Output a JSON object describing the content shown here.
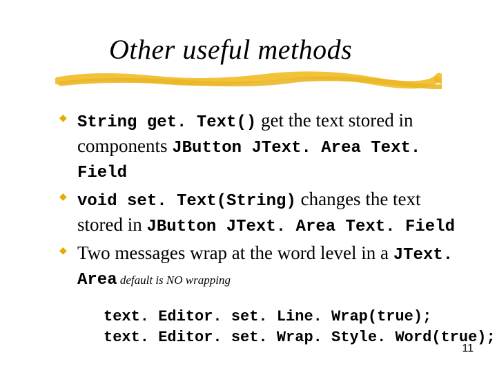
{
  "title": "Other useful methods",
  "bullets": [
    {
      "sig": "String get. Text()",
      "lead": " get the text stored in components ",
      "classes": "JButton JText. Area Text. Field"
    },
    {
      "sig": "void set. Text(String)",
      "lead": " changes the text stored in ",
      "classes": "JButton JText. Area Text. Field"
    },
    {
      "sig": "",
      "lead": "Two messages wrap at the word level in a ",
      "classes": "JText. Area",
      "note": " default is NO wrapping"
    }
  ],
  "code": [
    "text. Editor. set. Line. Wrap(true);",
    "text. Editor. set. Wrap. Style. Word(true);"
  ],
  "page_number": "11"
}
